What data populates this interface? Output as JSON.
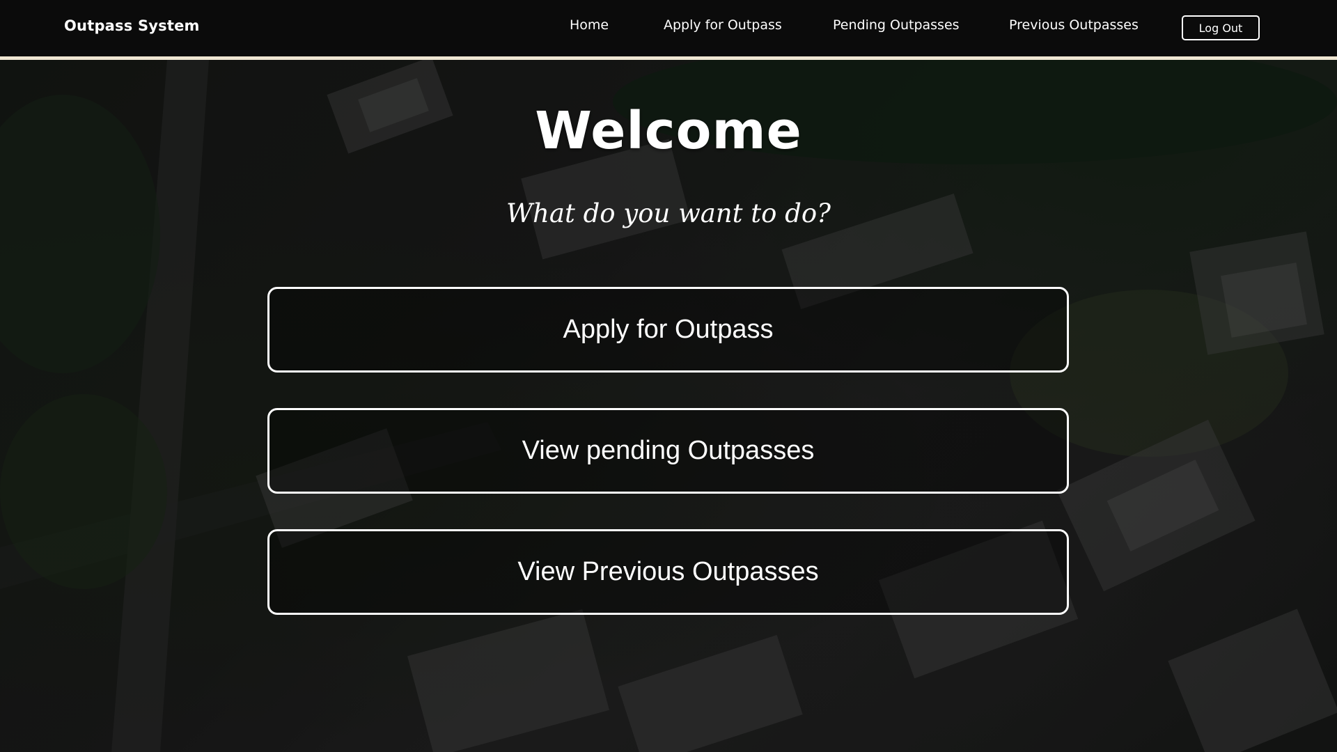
{
  "navbar": {
    "brand": "Outpass System",
    "links": [
      {
        "label": "Home"
      },
      {
        "label": "Apply for Outpass"
      },
      {
        "label": "Pending Outpasses"
      },
      {
        "label": "Previous Outpasses"
      }
    ],
    "logout_label": "Log Out"
  },
  "main": {
    "title": "Welcome",
    "subtitle": "What do you want to do?",
    "actions": [
      {
        "label": "Apply for Outpass"
      },
      {
        "label": "View pending Outpasses"
      },
      {
        "label": "View Previous Outpasses"
      }
    ]
  },
  "colors": {
    "navbar_bg": "#0b0b0b",
    "navbar_border": "#efe6d2",
    "text": "#ffffff"
  }
}
